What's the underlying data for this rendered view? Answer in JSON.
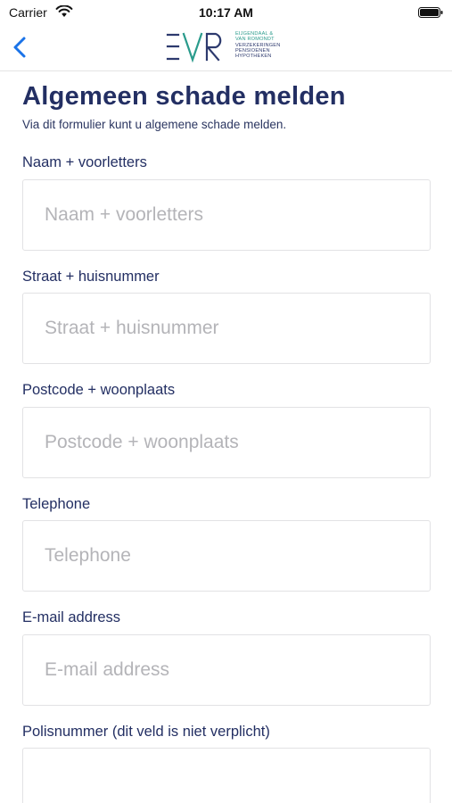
{
  "status_bar": {
    "carrier": "Carrier",
    "time": "10:17 AM"
  },
  "nav": {
    "back_icon": "chevron-left-icon",
    "logo": {
      "mark": "EVR",
      "lines": [
        "EIJGENDAAL &",
        "VAN ROMONDT",
        "VERZEKERINGEN",
        "PENSIOENEN",
        "HYPOTHEKEN"
      ]
    }
  },
  "form": {
    "title": "Algemeen schade melden",
    "subtitle": "Via dit formulier kunt u algemene schade melden.",
    "fields": [
      {
        "label": "Naam + voorletters",
        "placeholder": "Naam + voorletters",
        "value": ""
      },
      {
        "label": "Straat + huisnummer",
        "placeholder": "Straat + huisnummer",
        "value": ""
      },
      {
        "label": "Postcode + woonplaats",
        "placeholder": "Postcode + woonplaats",
        "value": ""
      },
      {
        "label": "Telephone",
        "placeholder": "Telephone",
        "value": ""
      },
      {
        "label": "E-mail address",
        "placeholder": "E-mail address",
        "value": ""
      },
      {
        "label": "Polisnummer (dit veld is niet verplicht)",
        "placeholder": "",
        "value": ""
      }
    ]
  },
  "colors": {
    "primary_text": "#232f63",
    "accent_blue": "#1a73e8",
    "logo_teal": "#2a9b8c",
    "input_border": "#e2e2e4",
    "placeholder": "#b4b4b8"
  }
}
